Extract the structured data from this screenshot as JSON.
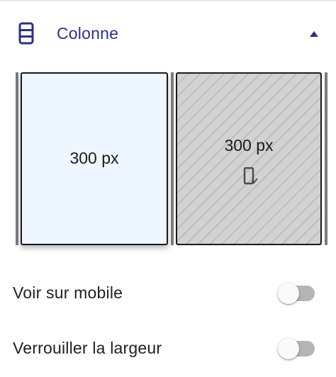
{
  "section": {
    "title": "Colonne",
    "icon": "columns-icon",
    "collapse_icon": "chevron-up-icon",
    "accent_color": "#2b2f8f"
  },
  "columns": [
    {
      "width_label": "300 px",
      "state": "selected",
      "background": "#eef6ff"
    },
    {
      "width_label": "300 px",
      "state": "hidden-on-mobile",
      "status_icon": "mobile-check-icon"
    }
  ],
  "toggles": [
    {
      "label": "Voir sur mobile",
      "checked": false
    },
    {
      "label": "Verrouiller la largeur",
      "checked": false
    }
  ]
}
